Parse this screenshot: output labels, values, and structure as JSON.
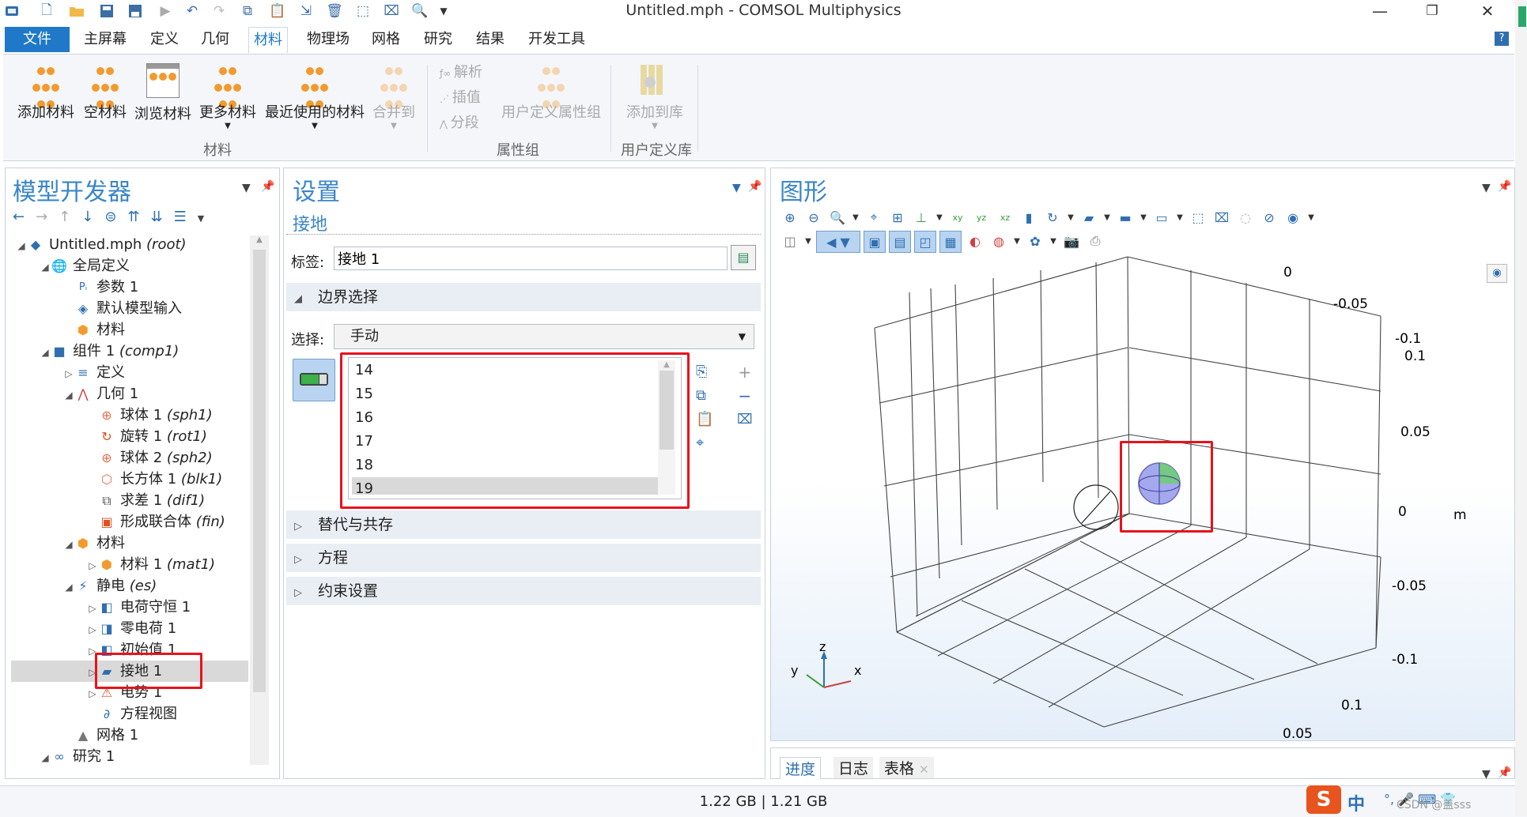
{
  "window": {
    "title": "Untitled.mph - COMSOL Multiphysics"
  },
  "menu": {
    "items": [
      "文件",
      "主屏幕",
      "定义",
      "几何",
      "材料",
      "物理场",
      "网格",
      "研究",
      "结果",
      "开发工具"
    ],
    "help": "?"
  },
  "ribbon": {
    "buttons": [
      "添加材料",
      "空材料",
      "浏览材料",
      "更多材料",
      "最近使用的材料",
      "合并到"
    ],
    "group_material": "材料",
    "small": [
      "解析",
      "插值",
      "分段"
    ],
    "user_prop": "用户定义属性组",
    "group_prop": "属性组",
    "add_lib": "添加到库",
    "group_user": "用户定义库"
  },
  "model_builder": {
    "title": "模型开发器",
    "tree": [
      {
        "label": "Untitled.mph",
        "tag": "(root)"
      },
      {
        "label": "全局定义",
        "tag": ""
      },
      {
        "label": "参数 1",
        "tag": ""
      },
      {
        "label": "默认模型输入",
        "tag": ""
      },
      {
        "label": "材料",
        "tag": ""
      },
      {
        "label": "组件 1",
        "tag": "(comp1)"
      },
      {
        "label": "定义",
        "tag": ""
      },
      {
        "label": "几何 1",
        "tag": ""
      },
      {
        "label": "球体 1",
        "tag": "(sph1)"
      },
      {
        "label": "旋转 1",
        "tag": "(rot1)"
      },
      {
        "label": "球体 2",
        "tag": "(sph2)"
      },
      {
        "label": "长方体 1",
        "tag": "(blk1)"
      },
      {
        "label": "求差 1",
        "tag": "(dif1)"
      },
      {
        "label": "形成联合体",
        "tag": "(fin)"
      },
      {
        "label": "材料",
        "tag": ""
      },
      {
        "label": "材料 1",
        "tag": "(mat1)"
      },
      {
        "label": "静电",
        "tag": "(es)"
      },
      {
        "label": "电荷守恒 1",
        "tag": ""
      },
      {
        "label": "零电荷 1",
        "tag": ""
      },
      {
        "label": "初始值 1",
        "tag": ""
      },
      {
        "label": "接地 1",
        "tag": ""
      },
      {
        "label": "电势 1",
        "tag": ""
      },
      {
        "label": "方程视图",
        "tag": ""
      },
      {
        "label": "网格 1",
        "tag": ""
      },
      {
        "label": "研究 1",
        "tag": ""
      }
    ]
  },
  "settings": {
    "title": "设置",
    "subtitle": "接地",
    "label_caption": "标签:",
    "label_value": "接地 1",
    "section_boundary": "边界选择",
    "selection_caption": "选择:",
    "selection_value": "手动",
    "boundaries": [
      "14",
      "15",
      "16",
      "17",
      "18",
      "19"
    ],
    "section_override": "替代与共存",
    "section_equation": "方程",
    "section_constraint": "约束设置"
  },
  "graphics": {
    "title": "图形",
    "axis_ticks": {
      "top": [
        "0",
        "-0.05",
        "-0.1"
      ],
      "right": [
        "0.1",
        "0.05",
        "0",
        "-0.05",
        "-0.1"
      ],
      "bottom": [
        "0.1",
        "0.05"
      ]
    },
    "unit": "m",
    "triad": {
      "z": "z",
      "y": "y",
      "x": "x"
    }
  },
  "bottom_tabs": [
    "进度",
    "日志",
    "表格"
  ],
  "status": {
    "memory": "1.22 GB | 1.21 GB",
    "ime": "中",
    "watermark": "CSDN @盖sss"
  },
  "colors": {
    "accent": "#1f79c8",
    "highlight": "#e8121c",
    "material": "#f29a2e"
  }
}
